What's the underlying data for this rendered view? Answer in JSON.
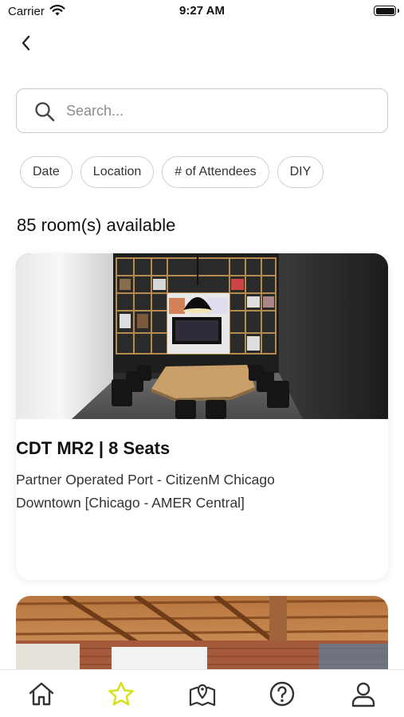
{
  "status_bar": {
    "carrier": "Carrier",
    "time": "9:27 AM"
  },
  "search": {
    "placeholder": "Search..."
  },
  "filters": [
    "Date",
    "Location",
    "# of Attendees",
    "DIY"
  ],
  "results": {
    "count_label": "85 room(s) available"
  },
  "rooms": [
    {
      "title": "CDT MR2 | 8 Seats",
      "subtitle_line1": "Partner Operated Port - CitizenM Chicago",
      "subtitle_line2": "Downtown [Chicago - AMER Central]"
    }
  ],
  "tabbar": {
    "active_tab": "favorites",
    "active_color": "#d8e021",
    "icons": [
      "home-icon",
      "star-icon",
      "map-icon",
      "help-icon",
      "profile-icon"
    ]
  }
}
